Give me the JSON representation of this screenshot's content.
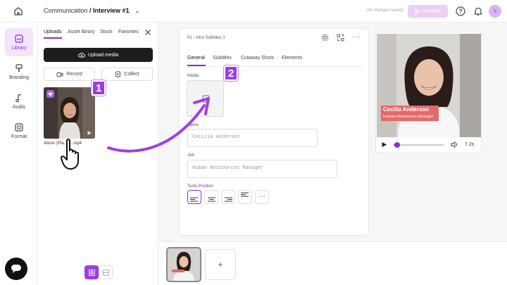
{
  "topbar": {
    "project": "Communication",
    "separator": " / ",
    "video": "Interview #1",
    "saved_status": "(All changes saved)",
    "preview_label": "Preview",
    "avatar_initial": "S"
  },
  "rail": {
    "items": [
      {
        "label": "Library",
        "icon": "library-icon",
        "active": true
      },
      {
        "label": "Branding",
        "icon": "branding-icon"
      },
      {
        "label": "Audio",
        "icon": "music-note-icon"
      },
      {
        "label": "Format",
        "icon": "format-icon"
      }
    ]
  },
  "library": {
    "tabs": [
      "Uploads",
      "Asset library",
      "Stock",
      "Favorites"
    ],
    "upload_label": "Upload media",
    "record_label": "Record",
    "collect_label": "Collect",
    "file_caption": "Alison (Pla… …mp4"
  },
  "editor": {
    "scene_title": "01 - Intro Subtitles 1",
    "subtabs": [
      "General",
      "Subtitles",
      "Cutaway Shots",
      "Elements"
    ],
    "media_label": "Media",
    "name_label": "Name",
    "name_value": "Cecilia Anderson",
    "job_label": "Job",
    "job_value": "Human Ressources Manager",
    "position_label": "Texts Position"
  },
  "preview": {
    "lower_third_name": "Cecilia Anderson",
    "lower_third_job": "Human Ressources Manager",
    "duration": "7.2s",
    "progress": 0.05
  },
  "timeline": {
    "add_label": "+"
  },
  "badges": {
    "one": "1",
    "two": "2"
  },
  "colors": {
    "accent": "#8a2be2",
    "lower_third": "#e36a6a"
  }
}
